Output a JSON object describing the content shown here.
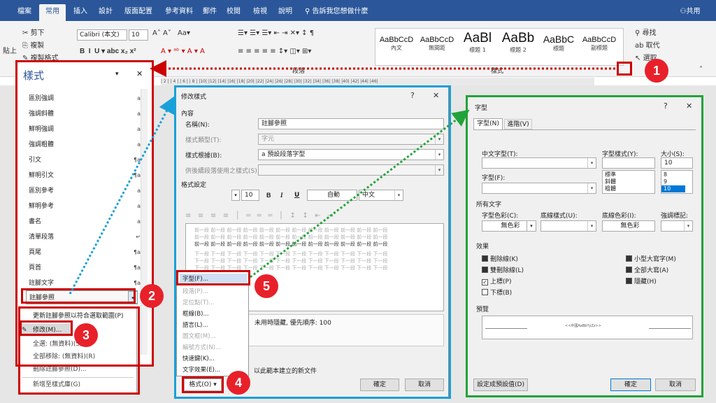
{
  "tabs": [
    "檔案",
    "常用",
    "插入",
    "設計",
    "版面配置",
    "參考資料",
    "郵件",
    "校閱",
    "檢視",
    "說明"
  ],
  "tell_me": "告訴我您想做什麼",
  "share": "共用",
  "clipboard": {
    "cut": "剪下",
    "copy": "複製",
    "paste": "貼上",
    "format_painter": "複製格式"
  },
  "font": {
    "name": "Calibri (本文)",
    "size": "10"
  },
  "style_gallery": [
    {
      "sample": "AaBbCcD",
      "name": "內文"
    },
    {
      "sample": "AaBbCcD",
      "name": "無間距"
    },
    {
      "sample": "AaBl",
      "name": "標題 1"
    },
    {
      "sample": "AaBb",
      "name": "標題 2"
    },
    {
      "sample": "AaBbC",
      "name": "標題"
    },
    {
      "sample": "AaBbCcD",
      "name": "副標題"
    }
  ],
  "groups": {
    "paragraph": "段落",
    "styles": "樣式"
  },
  "editing": {
    "find": "尋找",
    "replace": "取代",
    "select": "選取"
  },
  "ruler": "| 2 | | 4 | | 6 | | 8 | |10| |12| |14| |16| |18| |20| |22| |24| |26| |28| |30| |32| |34| |36| |38| |40| |42| |44| |46|",
  "styles_pane": {
    "title": "樣式",
    "items": [
      {
        "name": "區別強調",
        "glyph": "a"
      },
      {
        "name": "強調斜體",
        "glyph": "a"
      },
      {
        "name": "鮮明強調",
        "glyph": "a"
      },
      {
        "name": "強調粗體",
        "glyph": "a"
      },
      {
        "name": "引文",
        "glyph": "¶a"
      },
      {
        "name": "鮮明引文",
        "glyph": "¶a"
      },
      {
        "name": "區別參考",
        "glyph": "a"
      },
      {
        "name": "鮮明參考",
        "glyph": "a"
      },
      {
        "name": "書名",
        "glyph": "a"
      },
      {
        "name": "清單段落",
        "glyph": "↵"
      },
      {
        "name": "頁尾",
        "glyph": "¶a"
      },
      {
        "name": "頁首",
        "glyph": "¶a"
      },
      {
        "name": "註腳文字",
        "glyph": "¶a"
      },
      {
        "name": "註腳參照",
        "glyph": "a"
      }
    ]
  },
  "context_menu": {
    "update": "更新註腳參照以符合選取範圍(P)",
    "modify": "修改(M)...",
    "select_all": "全選: (無資料)(S)",
    "remove_all": "全部移除: (無資料)(R)",
    "delete": "刪除註腳參照(D)...",
    "add_gallery": "新增至樣式庫(G)"
  },
  "modify_dialog": {
    "title": "修改樣式",
    "help": "?",
    "section_props": "內容",
    "name_label": "名稱(N):",
    "name_value": "註腳參照",
    "type_label": "樣式類型(T):",
    "type_value": "字元",
    "based_label": "樣式根據(B):",
    "based_value": "a 預設段落字型",
    "next_label": "供後續段落使用之樣式(S):",
    "section_format": "格式設定",
    "size": "10",
    "bold": "B",
    "italic": "I",
    "underline": "U",
    "color": "自動",
    "lang": "中文",
    "preview_prev": "前一段 前一段 前一段 前一段 前一段 前一段 前一段 前一段 前一段 前一段 前一段 前一段",
    "preview_next": "下一段 下一段 下一段 下一段 下一段 下一段 下一段 下一段 下一段 下一段 下一段 下一段",
    "desc": "未用時隱藏, 優先順序: 100",
    "new_doc": "以此範本建立的新文件",
    "format_btn": "格式(O)",
    "ok": "確定",
    "cancel": "取消"
  },
  "format_menu": [
    "字型(F)...",
    "段落(P)...",
    "定位點(T)...",
    "框線(B)...",
    "語言(L)...",
    "圖文框(M)...",
    "編號方式(N)...",
    "快速鍵(K)...",
    "文字效果(E)..."
  ],
  "font_dialog": {
    "title": "字型",
    "help": "?",
    "tab_font": "字型(N)",
    "tab_adv": "進階(V)",
    "cjk_label": "中文字型(T):",
    "latin_label": "字型(F):",
    "style_label": "字型樣式(Y):",
    "styles": [
      "標準",
      "斜體",
      "粗體"
    ],
    "size_label": "大小(S):",
    "size_value": "10",
    "sizes": [
      "8",
      "9",
      "10"
    ],
    "all_text": "所有文字",
    "color_label": "字型色彩(C):",
    "color_value": "無色彩",
    "uline_label": "底線樣式(U):",
    "ucolor_label": "底線色彩(I):",
    "ucolor_value": "無色彩",
    "emph_label": "強調標記:",
    "effects": "效果",
    "fx": [
      {
        "label": "刪除線(K)",
        "state": "partial"
      },
      {
        "label": "雙刪除線(L)",
        "state": "partial"
      },
      {
        "label": "上標(P)",
        "state": "checked"
      },
      {
        "label": "下標(B)",
        "state": "off"
      },
      {
        "label": "小型大寫字(M)",
        "state": "partial"
      },
      {
        "label": "全部大寫(A)",
        "state": "partial"
      },
      {
        "label": "隱藏(H)",
        "state": "partial"
      }
    ],
    "preview": "預覽",
    "preview_text": "<<中國AaBbYyZz>>",
    "set_default": "設定成預設值(D)",
    "ok": "確定",
    "cancel": "取消"
  },
  "steps": [
    "1",
    "2",
    "3",
    "4",
    "5"
  ]
}
